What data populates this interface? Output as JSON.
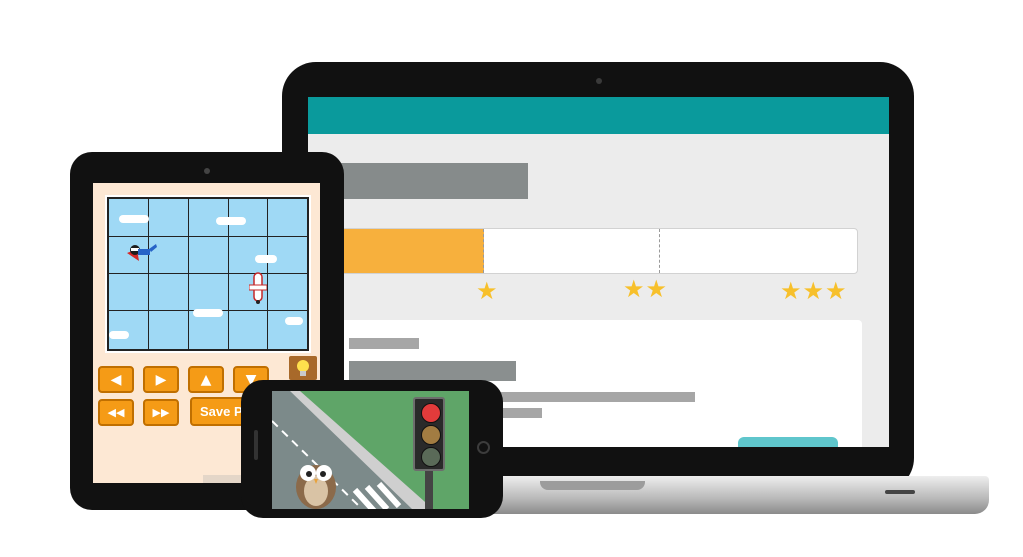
{
  "colors": {
    "laptop_header": "#0a9a9c",
    "progress_fill": "#f7b03d",
    "star": "#f7c02b",
    "tablet_background": "#fde8d4",
    "grid_sky": "#9fd9f5",
    "control_button": "#f59b16",
    "laptop_button": "#5fc6cc",
    "phone_grass": "#5fa568",
    "light_red": "#e23b3b",
    "light_amber": "#a27c42",
    "light_green": "#5a6a58"
  },
  "laptop": {
    "progress": {
      "fraction": 0.29
    },
    "star_rows": [
      "★",
      "★★",
      "★★★"
    ]
  },
  "tablet": {
    "controls": {
      "left_arrow": "◀",
      "right_arrow": "▶",
      "up_arrow": "▲",
      "down_arrow": "▼",
      "rewind": "◀◀",
      "fast_forward": "▶▶",
      "save_label": "Save Pla"
    },
    "characters": [
      "superhero",
      "airplane"
    ]
  },
  "phone": {
    "traffic_light": {
      "lights": [
        "red",
        "amber",
        "green"
      ]
    },
    "character": "owl"
  }
}
